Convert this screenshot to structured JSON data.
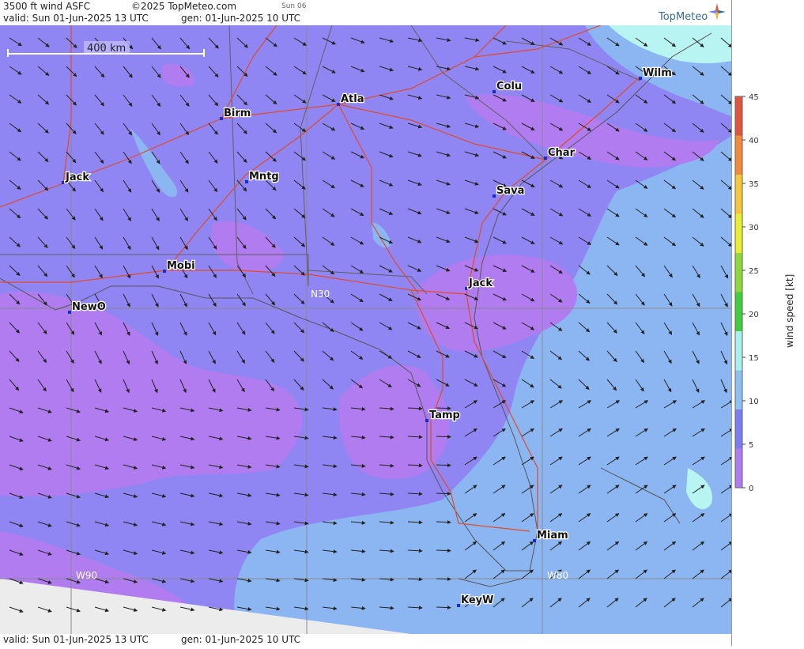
{
  "header": {
    "title": "3500 ft wind ASFC",
    "copyright": "©2025 TopMeteo.com",
    "day": "Sun 06",
    "valid": "valid:  Sun  01-Jun-2025  13 UTC",
    "gen": "gen: 01-Jun-2025 10 UTC"
  },
  "footer": {
    "valid": "valid:  Sun  01-Jun-2025  13 UTC",
    "gen": "gen: 01-Jun-2025 10 UTC"
  },
  "logo": {
    "text": "TopMeteo"
  },
  "scale": {
    "label": "400 km"
  },
  "grid_labels": {
    "w90": "W90",
    "w80": "W80",
    "n30": "N30"
  },
  "cities": [
    {
      "name": "Atla"
    },
    {
      "name": "Birm"
    },
    {
      "name": "Colu"
    },
    {
      "name": "Wilm"
    },
    {
      "name": "Char"
    },
    {
      "name": "Mntg"
    },
    {
      "name": "Jack"
    },
    {
      "name": "Sava"
    },
    {
      "name": "Mobi"
    },
    {
      "name": "Jack"
    },
    {
      "name": "NewO"
    },
    {
      "name": "Tamp"
    },
    {
      "name": "Miam"
    },
    {
      "name": "KeyW"
    }
  ],
  "colorbar": {
    "label": "wind speed [kt]",
    "ticks": [
      "45",
      "40",
      "35",
      "30",
      "25",
      "20",
      "15",
      "10",
      "5",
      "0"
    ],
    "colors": [
      "#e0553d",
      "#f08a3a",
      "#f5c53a",
      "#e8ee30",
      "#8ed83a",
      "#3ecf3a",
      "#a8f0ee",
      "#8cc0f0",
      "#7a7cf0",
      "#b07cf0"
    ]
  },
  "map_colors": {
    "wind_0_5": "#b07cf0",
    "wind_5_10": "#8f86f3",
    "wind_10_15": "#8cb6f2",
    "wind_15_20": "#b8f4f2",
    "nodata": "#ececec"
  }
}
